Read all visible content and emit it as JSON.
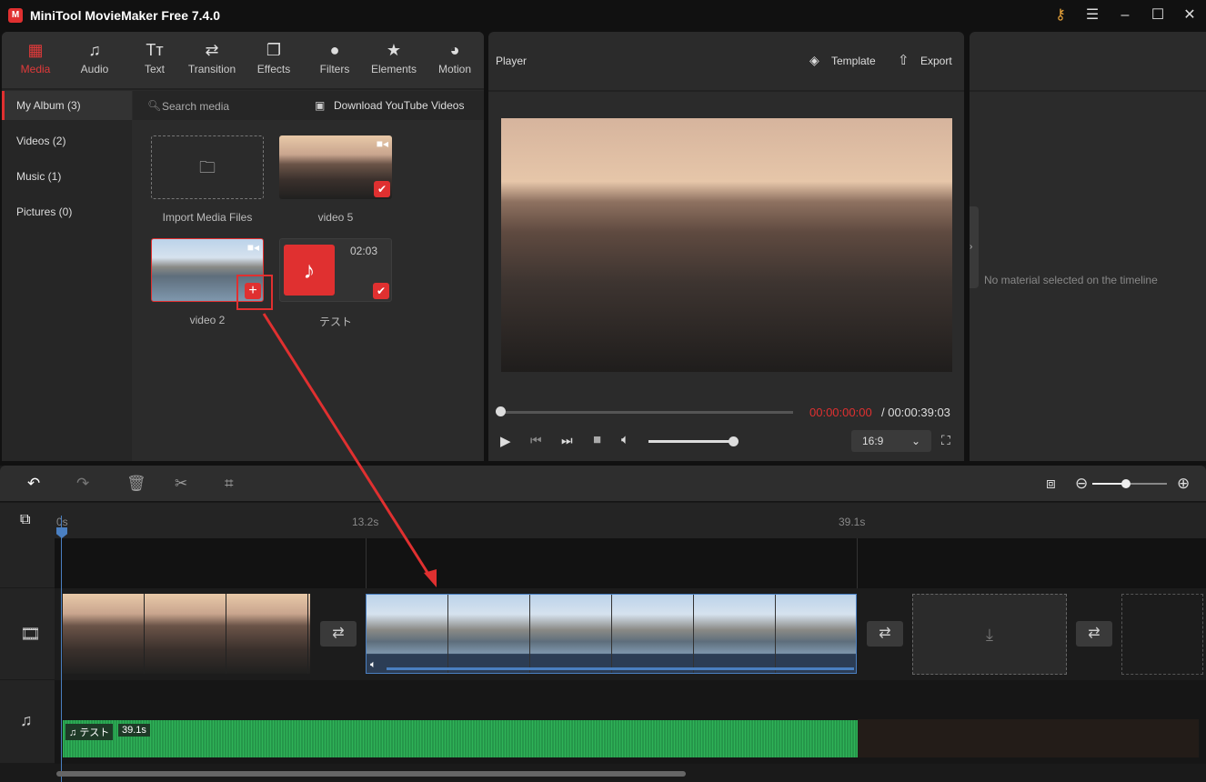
{
  "app": {
    "title": "MiniTool MovieMaker Free 7.4.0"
  },
  "toolbar": [
    {
      "label": "Media",
      "icon": "media-folder-icon",
      "active": true
    },
    {
      "label": "Audio",
      "icon": "music-note-icon"
    },
    {
      "label": "Text",
      "icon": "text-icon"
    },
    {
      "label": "Transition",
      "icon": "transition-arrows-icon"
    },
    {
      "label": "Effects",
      "icon": "effects-icon"
    },
    {
      "label": "Filters",
      "icon": "filters-icon"
    },
    {
      "label": "Elements",
      "icon": "elements-icon"
    },
    {
      "label": "Motion",
      "icon": "motion-icon"
    }
  ],
  "sidebar": [
    {
      "label": "My Album (3)",
      "active": true
    },
    {
      "label": "Videos (2)"
    },
    {
      "label": "Music (1)"
    },
    {
      "label": "Pictures (0)"
    }
  ],
  "media": {
    "search_placeholder": "Search media",
    "download": "Download YouTube Videos",
    "import": "Import Media Files",
    "items": [
      {
        "name": "video 5",
        "type": "video",
        "added": true
      },
      {
        "name": "video 2",
        "type": "video",
        "added": false
      },
      {
        "name": "テスト",
        "type": "audio",
        "duration": "02:03",
        "added": true
      }
    ]
  },
  "player": {
    "title": "Player",
    "template": "Template",
    "export": "Export",
    "current_time": "00:00:00:00",
    "total_time": "/ 00:00:39:03",
    "aspect": "16:9",
    "progress": 0,
    "volume": 0.9
  },
  "properties": {
    "empty": "No material selected on the timeline"
  },
  "timeline": {
    "ruler": [
      "0s",
      "13.2s",
      "39.1s"
    ],
    "audio_clip": {
      "name": "テスト",
      "duration": "39.1s"
    },
    "zoom": 0.6
  },
  "colors": {
    "accent": "#e03030",
    "playhead": "#4a7fc1",
    "audio": "#27a24d"
  }
}
